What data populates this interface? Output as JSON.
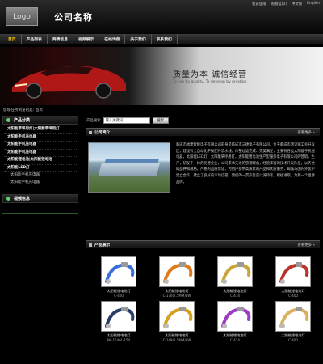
{
  "header": {
    "logo_text": "Logo",
    "company_name": "公司名称",
    "links": [
      "会员登陆",
      "购物篮(0)",
      "中文版",
      "English"
    ]
  },
  "nav": [
    "首页",
    "产品列表",
    "商情信息",
    "视频展示",
    "在线询盘",
    "关于我们",
    "联系我们"
  ],
  "banner": {
    "slogan": "质量为本  诚信经营",
    "slogan_en": "To live by quality, To develop by prestige"
  },
  "location": "您现在所浏览的是: 首页",
  "sidebar": {
    "category_title": "产品分类",
    "categories": [
      {
        "label": "太阳能草坪用灯|太阳能草坪用灯",
        "sub": false
      },
      {
        "label": "太阳能手机充电器",
        "sub": false
      },
      {
        "label": "太阳能手机充电器",
        "sub": false
      },
      {
        "label": "太阳能手机充电器",
        "sub": false
      },
      {
        "label": "太阳能锂电池|太阳能锂电池",
        "sub": false
      },
      {
        "label": "太阳能LED灯",
        "sub": false
      },
      {
        "label": "太阳能手机充电器",
        "sub": true
      },
      {
        "label": "太阳能手机充电器",
        "sub": true
      }
    ],
    "video_title": "视频信息"
  },
  "search": {
    "label": "产品搜索",
    "placeholder": "输入关键词",
    "button": "搜索"
  },
  "intro": {
    "title": "公司简介",
    "more": "查看更多 »",
    "text": "临成市福建智能电子有限公司前身是临成市三捷电子有限公司。位于临成市清流镇工业开发区，建设有全自动化平衡配件流水线，体整过滤完成、完美满足，主要有各类太阳能手机充电器，太阳能LED灯，太阳能草坪用灯，太阳能锂电池生产型服务电子有限公司的营销，生产，研发于一体的民营企业，公司秉承先进的管理理念，经验丰富的技术开发队伍，以齐全的品种和规格，严格的品质保证，为用户提供高质素的产品和优质服务，竭诚与国内外客户建立合作，建立了良好的市场信誉。我们的一贯宗旨是以诚待客，积极进取，为新一个世界品牌。"
  },
  "products": {
    "title": "产品展示",
    "more": "查看更多 »",
    "items": [
      {
        "name": "太阳能锂电池灯",
        "code": "C-400",
        "color": "#3a6fd8"
      },
      {
        "name": "太阳能锂电池灯",
        "code": "C-170(2.5MM)8W",
        "color": "#e07a1c"
      },
      {
        "name": "太阳能锂电池灯",
        "code": "C-414",
        "color": "#c9a43a"
      },
      {
        "name": "太阳能锂电池灯",
        "code": "C-400",
        "color": "#b8342b"
      },
      {
        "name": "太阳能锂电池灯",
        "code": "NL-1546L-154",
        "color": "#2a3d66"
      },
      {
        "name": "太阳能锂电池灯",
        "code": "C-149(2.5MM)8W",
        "color": "#d6a020"
      },
      {
        "name": "太阳能锂电池灯",
        "code": "C-414",
        "color": "#9a3cc4"
      },
      {
        "name": "太阳能锂电池灯",
        "code": "C-400",
        "color": "#d8b060"
      }
    ]
  }
}
